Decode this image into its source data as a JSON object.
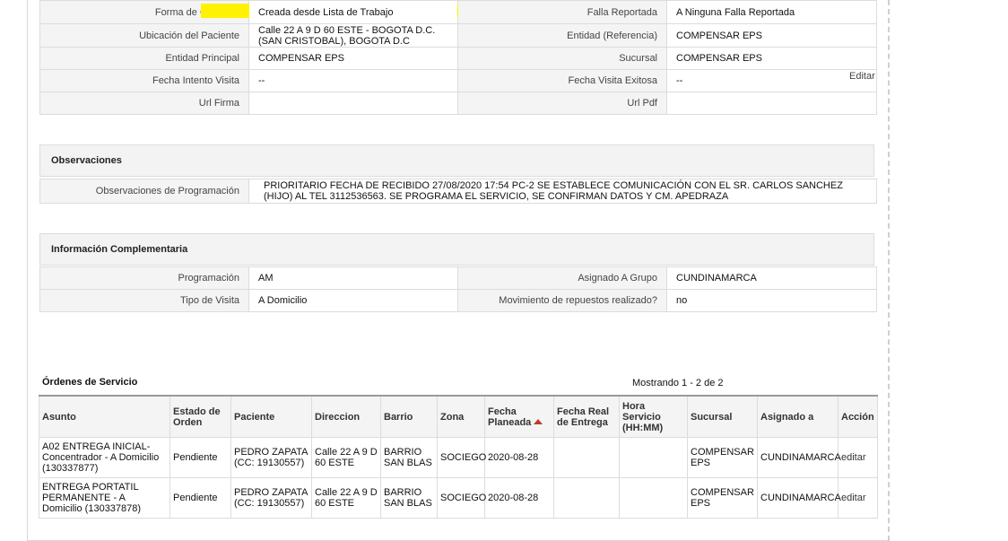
{
  "details": {
    "rows": [
      {
        "l1": "Forma de Creación",
        "v1": "Creada desde Lista de Trabajo",
        "l2": "Falla Reportada",
        "v2": "A Ninguna Falla Reportada"
      },
      {
        "l1": "Ubicación del Paciente",
        "v1": "Calle 22 A 9 D 60 ESTE - BOGOTA D.C. (SAN CRISTOBAL), BOGOTA D.C",
        "l2": "Entidad (Referencia)",
        "v2": "COMPENSAR EPS"
      },
      {
        "l1": "Entidad Principal",
        "v1": "COMPENSAR EPS",
        "l2": "Sucursal",
        "v2": "COMPENSAR EPS"
      },
      {
        "l1": "Fecha Intento Visita",
        "v1": "--",
        "l2": "Fecha Visita Exitosa",
        "v2": "--"
      },
      {
        "l1": "Url Firma",
        "v1": "",
        "l2": "Url Pdf",
        "v2": ""
      }
    ],
    "edit_label": "Editar"
  },
  "observaciones": {
    "title": "Observaciones",
    "label": "Observaciones de Programación",
    "value": "PRIORITARIO FECHA DE RECIBIDO 27/08/2020 17:54 PC-2 SE ESTABLECE COMUNICACIÓN CON EL SR. CARLOS SANCHEZ (HIJO) AL TEL 3112536563. SE PROGRAMA EL SERVICIO, SE CONFIRMAN DATOS Y CM. APEDRAZA"
  },
  "complementaria": {
    "title": "Información Complementaria",
    "rows": [
      {
        "l1": "Programación",
        "v1": "AM",
        "l2": "Asignado A Grupo",
        "v2": "CUNDINAMARCA"
      },
      {
        "l1": "Tipo de Visita",
        "v1": "A Domicilio",
        "l2": "Movimiento de repuestos realizado?",
        "v2": "no"
      }
    ]
  },
  "orders": {
    "title": "Órdenes de Servicio",
    "count": "Mostrando 1 - 2 de 2",
    "headers": [
      "Asunto",
      "Estado de Orden",
      "Paciente",
      "Direccion",
      "Barrio",
      "Zona",
      "Fecha Planeada",
      "Fecha Real de Entrega",
      "Hora Servicio (HH:MM)",
      "Sucursal",
      "Asignado a",
      "Acción"
    ],
    "rows": [
      [
        "A02 ENTREGA INICIAL- Concentrador - A Domicilio (130337877)",
        "Pendiente",
        "PEDRO ZAPATA (CC: 19130557)",
        "Calle 22 A 9 D 60 ESTE",
        "BARRIO SAN BLAS",
        "SOCIEGO",
        "2020-08-28",
        "",
        "",
        "COMPENSAR EPS",
        "CUNDINAMARCA",
        "editar"
      ],
      [
        "ENTREGA PORTATIL PERMANENTE - A Domicilio (130337878)",
        "Pendiente",
        "PEDRO ZAPATA (CC: 19130557)",
        "Calle 22 A 9 D 60 ESTE",
        "BARRIO SAN BLAS",
        "SOCIEGO",
        "2020-08-28",
        "",
        "",
        "COMPENSAR EPS",
        "CUNDINAMARCA",
        "editar"
      ]
    ]
  },
  "colors": {
    "highlight": "#fff200",
    "sort_arrow": "#c0392b"
  }
}
